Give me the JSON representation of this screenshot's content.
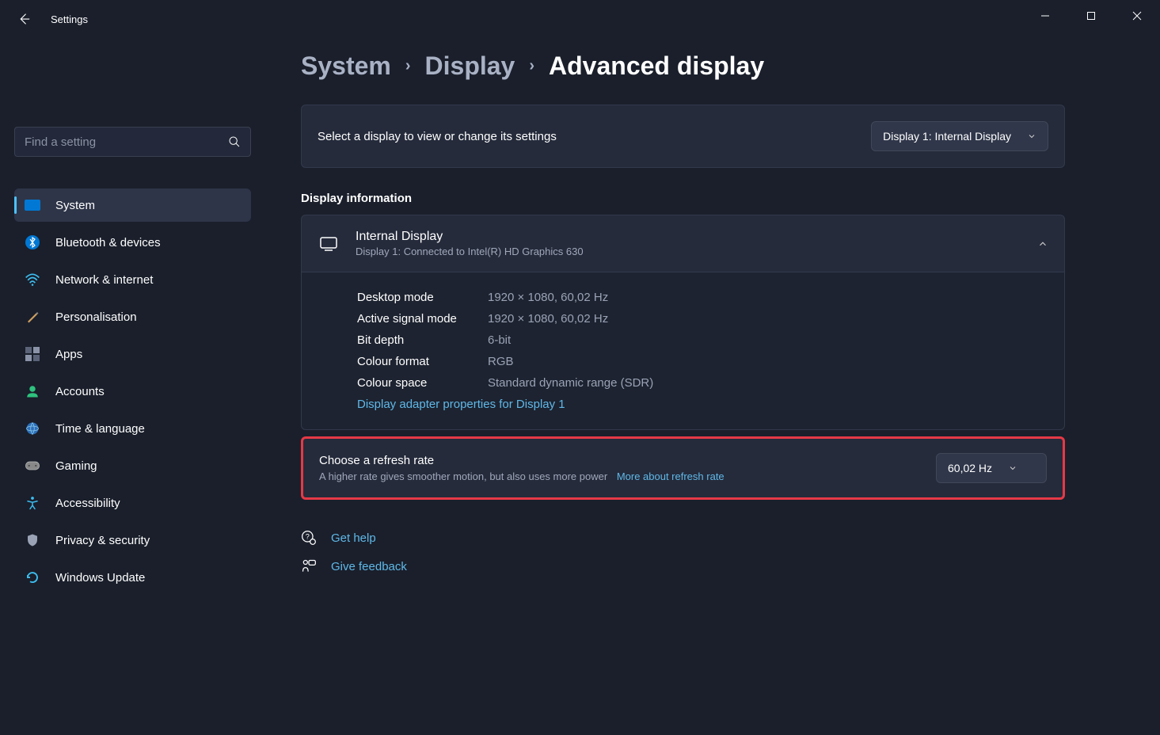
{
  "window": {
    "title": "Settings"
  },
  "search": {
    "placeholder": "Find a setting"
  },
  "nav": [
    {
      "icon": "💻",
      "label": "System",
      "active": true,
      "color": "#0078d4"
    },
    {
      "icon": "bt",
      "label": "Bluetooth & devices"
    },
    {
      "icon": "wifi",
      "label": "Network & internet"
    },
    {
      "icon": "🖌️",
      "label": "Personalisation"
    },
    {
      "icon": "apps",
      "label": "Apps"
    },
    {
      "icon": "👤",
      "label": "Accounts"
    },
    {
      "icon": "🌐",
      "label": "Time & language"
    },
    {
      "icon": "🎮",
      "label": "Gaming"
    },
    {
      "icon": "acc",
      "label": "Accessibility"
    },
    {
      "icon": "🛡️",
      "label": "Privacy & security"
    },
    {
      "icon": "🔄",
      "label": "Windows Update"
    }
  ],
  "breadcrumb": {
    "part1": "System",
    "part2": "Display",
    "current": "Advanced display"
  },
  "select_display": {
    "prompt": "Select a display to view or change its settings",
    "value": "Display 1: Internal Display"
  },
  "section": {
    "title": "Display information"
  },
  "display_info": {
    "title": "Internal Display",
    "subtitle": "Display 1: Connected to Intel(R) HD Graphics 630",
    "rows": [
      {
        "label": "Desktop mode",
        "value": "1920 × 1080, 60,02 Hz"
      },
      {
        "label": "Active signal mode",
        "value": "1920 × 1080, 60,02 Hz"
      },
      {
        "label": "Bit depth",
        "value": "6-bit"
      },
      {
        "label": "Colour format",
        "value": "RGB"
      },
      {
        "label": "Colour space",
        "value": "Standard dynamic range (SDR)"
      }
    ],
    "adapter_link": "Display adapter properties for Display 1"
  },
  "refresh": {
    "title": "Choose a refresh rate",
    "sub": "A higher rate gives smoother motion, but also uses more power",
    "more_link": "More about refresh rate",
    "value": "60,02 Hz"
  },
  "help": {
    "get_help": "Get help",
    "feedback": "Give feedback"
  }
}
